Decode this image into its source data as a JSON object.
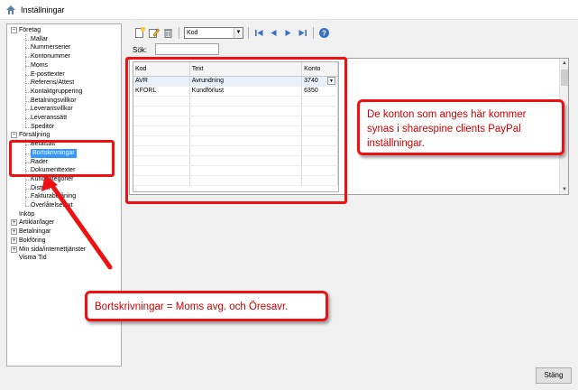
{
  "window": {
    "title": "Inställningar"
  },
  "tree": {
    "items": [
      {
        "label": "Företag",
        "level": 0,
        "expander": "−"
      },
      {
        "label": "Mallar",
        "level": 1
      },
      {
        "label": "Nummerserier",
        "level": 1
      },
      {
        "label": "Kontonummer",
        "level": 1
      },
      {
        "label": "Moms",
        "level": 1
      },
      {
        "label": "E-posttexter",
        "level": 1
      },
      {
        "label": "Referens/Attest",
        "level": 1
      },
      {
        "label": "Kontaktgruppering",
        "level": 1
      },
      {
        "label": "Betalningsvillkor",
        "level": 1
      },
      {
        "label": "Leveransvillkor",
        "level": 1
      },
      {
        "label": "Leveranssätt",
        "level": 1
      },
      {
        "label": "Speditör",
        "level": 1
      },
      {
        "label": "Försäljning",
        "level": 0,
        "expander": "−"
      },
      {
        "label": "Betalsätt",
        "level": 1
      },
      {
        "label": "Bortskrivningar",
        "level": 1,
        "selected": true
      },
      {
        "label": "Rader",
        "level": 1
      },
      {
        "label": "Dokumenttexter",
        "level": 1
      },
      {
        "label": "Kundkategorier",
        "level": 1
      },
      {
        "label": "Distrikt",
        "level": 1
      },
      {
        "label": "Fakturabelåning",
        "level": 1
      },
      {
        "label": "Överlåtelsetext",
        "level": 1
      },
      {
        "label": "Inköp",
        "level": 0
      },
      {
        "label": "Artiklar/lager",
        "level": 0,
        "expander": "+"
      },
      {
        "label": "Betalningar",
        "level": 0,
        "expander": "+"
      },
      {
        "label": "Bokföring",
        "level": 0,
        "expander": "+"
      },
      {
        "label": "Min sida/internettjänster",
        "level": 0,
        "expander": "+"
      },
      {
        "label": "Visma Tid",
        "level": 0
      }
    ]
  },
  "toolbar": {
    "icons": [
      "new-icon",
      "edit-icon",
      "delete-icon",
      "first-icon",
      "prev-icon",
      "next-icon",
      "last-icon",
      "help-icon"
    ],
    "combo_value": "Kod"
  },
  "search": {
    "label": "Sök:",
    "value": ""
  },
  "grid": {
    "columns": [
      "Kod",
      "Text",
      "Konto"
    ],
    "rows": [
      {
        "kod": "AVR",
        "text": "Avrundning",
        "konto": "3740"
      },
      {
        "kod": "KFÖRL",
        "text": "Kundförlust",
        "konto": "6350"
      }
    ]
  },
  "callouts": {
    "right": "De konton som anges här kommer synas i sharespine clients PayPal inställningar.",
    "bottom": "Bortskrivningar = Moms avg. och Öresavr."
  },
  "colors": {
    "annotation": "#e11111",
    "selection": "#3399ff"
  },
  "buttons": {
    "close": "Stäng"
  }
}
